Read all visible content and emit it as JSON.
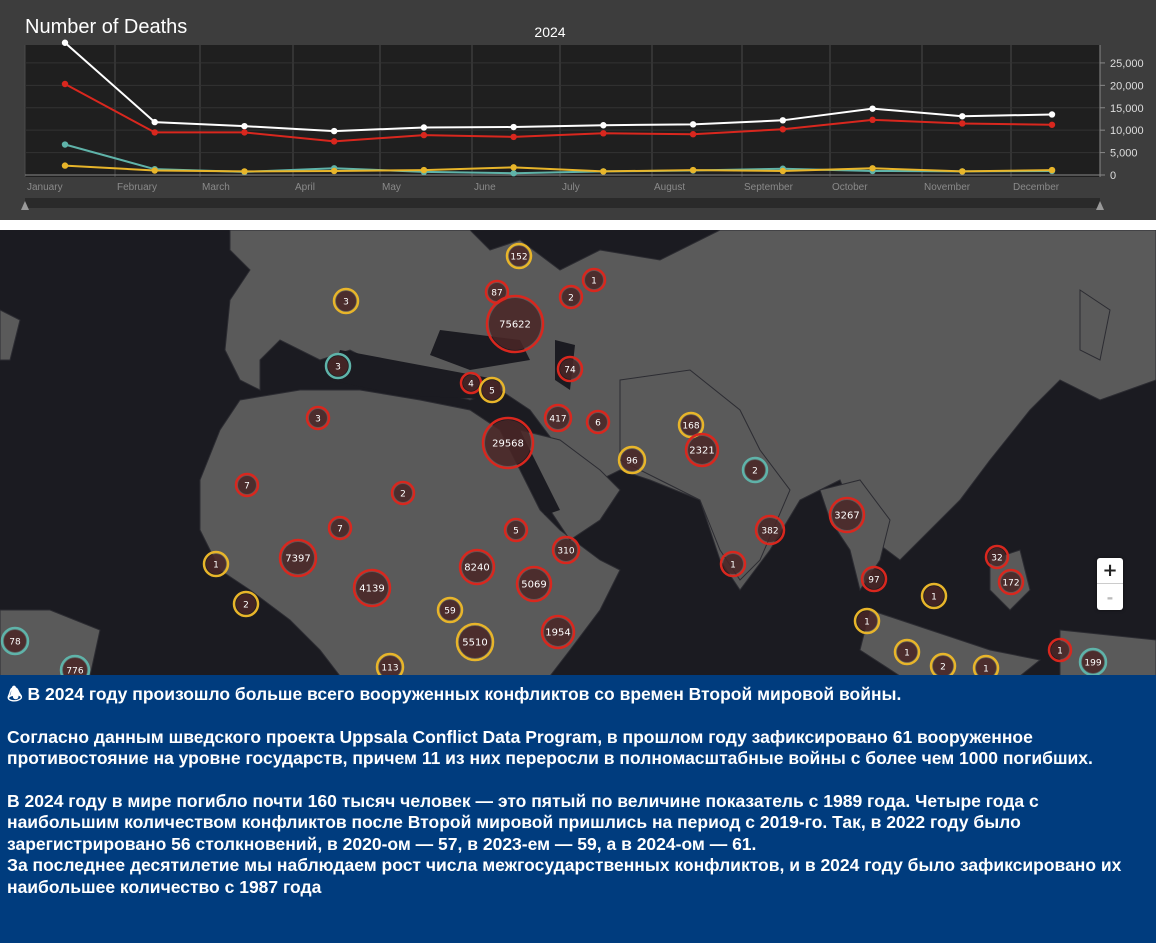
{
  "chart": {
    "title": "Number of Deaths",
    "year": "2024"
  },
  "chart_data": {
    "type": "line",
    "title": "Number of Deaths",
    "subtitle": "2024",
    "categories": [
      "January",
      "February",
      "March",
      "April",
      "May",
      "June",
      "July",
      "August",
      "September",
      "October",
      "November",
      "December"
    ],
    "y_ticks": [
      "0",
      "5,000",
      "10,000",
      "15,000",
      "20,000",
      "25,000"
    ],
    "ylim": [
      0,
      29000
    ],
    "grid": true,
    "series": [
      {
        "color": "#ffffff",
        "values": [
          29500,
          11800,
          10900,
          9800,
          10600,
          10700,
          11100,
          11300,
          12200,
          14800,
          13100,
          13500
        ]
      },
      {
        "color": "#d9271e",
        "values": [
          20300,
          9500,
          9500,
          7500,
          8900,
          8500,
          9300,
          9100,
          10200,
          12300,
          11500,
          11200
        ]
      },
      {
        "color": "#5fb3a9",
        "values": [
          6800,
          1300,
          700,
          1500,
          700,
          400,
          800,
          1000,
          1400,
          900,
          800,
          900
        ]
      },
      {
        "color": "#e8b52a",
        "values": [
          2100,
          1000,
          800,
          900,
          1100,
          1700,
          800,
          1100,
          900,
          1500,
          800,
          1100
        ]
      }
    ]
  },
  "map": {
    "clusters": [
      {
        "label": "152",
        "color": "#e8b52a"
      },
      {
        "label": "1",
        "color": "#d9271e"
      },
      {
        "label": "87",
        "color": "#d9271e"
      },
      {
        "label": "2",
        "color": "#d9271e"
      },
      {
        "label": "3",
        "color": "#e8b52a"
      },
      {
        "label": "75622",
        "color": "#d9271e"
      },
      {
        "label": "3",
        "color": "#5fb3a9"
      },
      {
        "label": "74",
        "color": "#d9271e"
      },
      {
        "label": "4",
        "color": "#d9271e"
      },
      {
        "label": "5",
        "color": "#e8b52a"
      },
      {
        "label": "3",
        "color": "#d9271e"
      },
      {
        "label": "417",
        "color": "#d9271e"
      },
      {
        "label": "6",
        "color": "#d9271e"
      },
      {
        "label": "29568",
        "color": "#d9271e"
      },
      {
        "label": "168",
        "color": "#e8b52a"
      },
      {
        "label": "2321",
        "color": "#d9271e"
      },
      {
        "label": "96",
        "color": "#e8b52a"
      },
      {
        "label": "2",
        "color": "#5fb3a9"
      },
      {
        "label": "7",
        "color": "#d9271e"
      },
      {
        "label": "2",
        "color": "#d9271e"
      },
      {
        "label": "7",
        "color": "#d9271e"
      },
      {
        "label": "5",
        "color": "#d9271e"
      },
      {
        "label": "310",
        "color": "#d9271e"
      },
      {
        "label": "382",
        "color": "#d9271e"
      },
      {
        "label": "3267",
        "color": "#d9271e"
      },
      {
        "label": "1",
        "color": "#e8b52a"
      },
      {
        "label": "7397",
        "color": "#d9271e"
      },
      {
        "label": "4139",
        "color": "#d9271e"
      },
      {
        "label": "8240",
        "color": "#d9271e"
      },
      {
        "label": "5069",
        "color": "#d9271e"
      },
      {
        "label": "1",
        "color": "#d9271e"
      },
      {
        "label": "32",
        "color": "#d9271e"
      },
      {
        "label": "172",
        "color": "#d9271e"
      },
      {
        "label": "97",
        "color": "#d9271e"
      },
      {
        "label": "1",
        "color": "#e8b52a"
      },
      {
        "label": "1",
        "color": "#e8b52a"
      },
      {
        "label": "59",
        "color": "#e8b52a"
      },
      {
        "label": "2",
        "color": "#e8b52a"
      },
      {
        "label": "1954",
        "color": "#d9271e"
      },
      {
        "label": "5510",
        "color": "#e8b52a"
      },
      {
        "label": "78",
        "color": "#5fb3a9"
      },
      {
        "label": "1",
        "color": "#e8b52a"
      },
      {
        "label": "1",
        "color": "#d9271e"
      },
      {
        "label": "776",
        "color": "#5fb3a9"
      },
      {
        "label": "113",
        "color": "#e8b52a"
      },
      {
        "label": "2",
        "color": "#e8b52a"
      },
      {
        "label": "1",
        "color": "#e8b52a"
      },
      {
        "label": "199",
        "color": "#5fb3a9"
      }
    ],
    "zoom_in": "+",
    "zoom_out": "-"
  },
  "text": {
    "line1": "🕭 В 2024 году произошло больше всего вооруженных конфликтов со времен Второй мировой войны.",
    "para2": "Согласно данным шведского проекта Uppsala Conflict Data Program, в прошлом году зафиксировано 61 вооруженное противостояние на уровне государств, причем 11 из них переросли в полномасштабные войны с более чем 1000 погибших.",
    "para3": "В 2024 году в мире погибло почти 160 тысяч человек — это пятый по величине показатель с 1989 года. Четыре года с наибольшим количеством конфликтов после Второй мировой пришлись на период с 2019-го. Так, в 2022 году было зарегистрировано 56 столкновений, в 2020-ом — 57, в 2023-ем — 59, а в 2024-ом — 61.",
    "para4": "За последнее десятилетие мы наблюдаем рост числа межгосударственных конфликтов, и в 2024 году было зафиксировано их наибольшее количество с 1987 года"
  }
}
